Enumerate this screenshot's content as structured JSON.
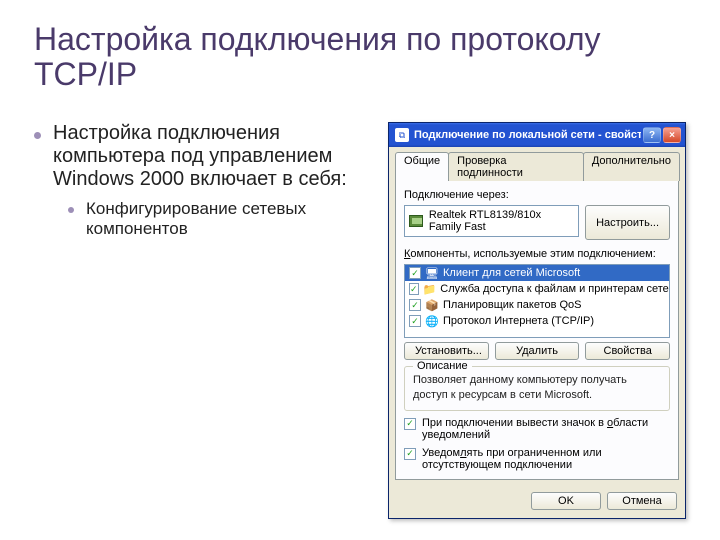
{
  "slide": {
    "title": "Настройка подключения по протоколу TCP/IP",
    "bullet_main": "Настройка подключения компьютера под управлением Windows 2000 включает в себя:",
    "bullet_sub": "Конфигурирование сетевых компонентов"
  },
  "dialog": {
    "title": "Подключение по локальной сети - свойства",
    "tabs": {
      "general": "Общие",
      "auth": "Проверка подлинности",
      "advanced": "Дополнительно"
    },
    "connect_via_label": "Подключение через:",
    "adapter_name": "Realtek RTL8139/810x Family Fast",
    "configure_btn": "Настроить...",
    "components_label": "Компоненты, используемые этим подключением:",
    "items": [
      {
        "label": "Клиент для сетей Microsoft",
        "icon": "🖥",
        "selected": true
      },
      {
        "label": "Служба доступа к файлам и принтерам сетей Micro...",
        "icon": "📁",
        "selected": false
      },
      {
        "label": "Планировщик пакетов QoS",
        "icon": "📦",
        "selected": false
      },
      {
        "label": "Протокол Интернета (TCP/IP)",
        "icon": "🌐",
        "selected": false
      }
    ],
    "install_btn": "Установить...",
    "remove_btn": "Удалить",
    "props_btn": "Свойства",
    "desc_group_title": "Описание",
    "desc_text": "Позволяет данному компьютеру получать доступ к ресурсам в сети Microsoft.",
    "chk_tray_prefix": "При подключении вывести значок в ",
    "chk_tray_underlined": "о",
    "chk_tray_suffix": "бласти уведомлений",
    "chk_limited_prefix": "Уведом",
    "chk_limited_underlined": "л",
    "chk_limited_suffix": "ять при ограниченном или отсутствующем подключении",
    "ok_btn": "OK",
    "cancel_btn": "Отмена"
  }
}
